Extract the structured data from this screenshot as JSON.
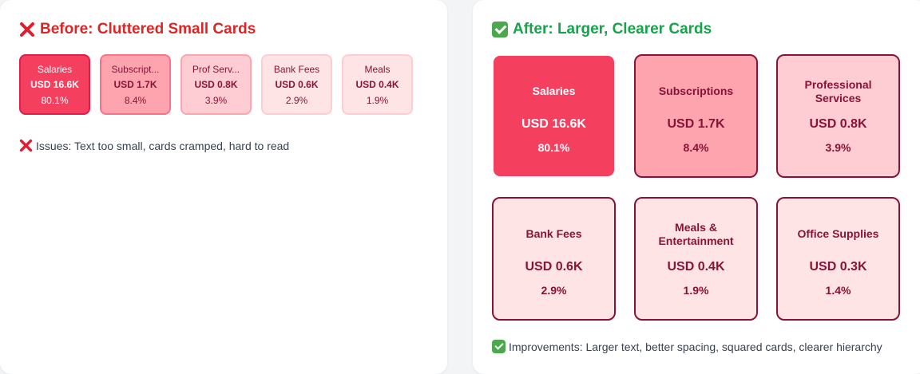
{
  "before": {
    "title": "Before: Cluttered Small Cards",
    "title_icon": "x-icon",
    "cards": [
      {
        "name": "Salaries",
        "amount": "USD 16.6K",
        "pct": "80.1%"
      },
      {
        "name": "Subscript...",
        "amount": "USD 1.7K",
        "pct": "8.4%"
      },
      {
        "name": "Prof Serv...",
        "amount": "USD 0.8K",
        "pct": "3.9%"
      },
      {
        "name": "Bank Fees",
        "amount": "USD 0.6K",
        "pct": "2.9%"
      },
      {
        "name": "Meals",
        "amount": "USD 0.4K",
        "pct": "1.9%"
      }
    ],
    "issues_text": "Issues: Text too small, cards cramped, hard to read"
  },
  "after": {
    "title": "After: Larger, Clearer Cards",
    "title_icon": "check-icon",
    "cards": [
      {
        "name": "Salaries",
        "amount": "USD 16.6K",
        "pct": "80.1%"
      },
      {
        "name": "Subscriptions",
        "amount": "USD 1.7K",
        "pct": "8.4%"
      },
      {
        "name": "Professional Services",
        "amount": "USD 0.8K",
        "pct": "3.9%"
      },
      {
        "name": "Bank Fees",
        "amount": "USD 0.6K",
        "pct": "2.9%"
      },
      {
        "name": "Meals & Entertainment",
        "amount": "USD 0.4K",
        "pct": "1.9%"
      },
      {
        "name": "Office Supplies",
        "amount": "USD 0.3K",
        "pct": "1.4%"
      }
    ],
    "improvements_text": "Improvements: Larger text, better spacing, squared cards, clearer hierarchy"
  },
  "colors": {
    "bad_title": "#dc2626",
    "good_title": "#16a34a",
    "card_level_1": "#f43f5e",
    "card_level_2": "#fda4af",
    "card_level_3": "#fecdd3",
    "card_level_4": "#ffe4e6"
  }
}
